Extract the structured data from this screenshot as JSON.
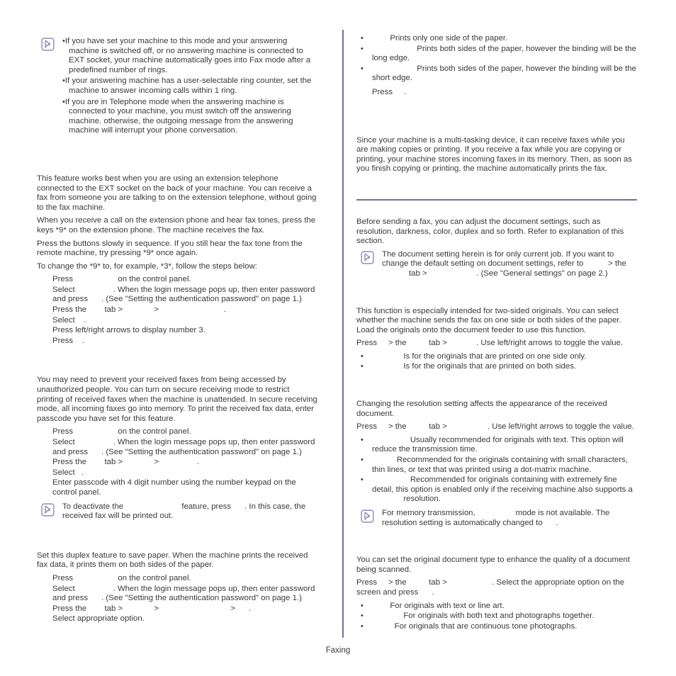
{
  "page": {
    "footer_label": "Faxing",
    "accent_color": "#6f6f9e",
    "text_color": "#3a3a3a",
    "background_color": "#ffffff",
    "hidden_term_color": "#ffffff"
  },
  "left_column": {
    "note_ans_machine": {
      "icon": "note-pencil-icon",
      "bullets": [
        "If you have set your machine to this mode and your answering machine is switched off, or no answering machine is connected to EXT socket, your machine automatically goes into Fax mode after a predefined number of rings.",
        "If your answering machine has a user-selectable ring counter, set the machine to answer incoming calls within 1 ring.",
        "If you are in Telephone mode when the answering machine is connected to your machine, you must switch off the answering machine. otherwise, the outgoing message from the answering machine will interrupt your phone conversation."
      ]
    },
    "section_ext_phone": {
      "heading": "",
      "paragraphs": [
        "This feature works best when you are using an extension telephone connected to the EXT socket on the back of your machine. You can receive a fax from someone you are talking to on the extension telephone, without going to the fax machine.",
        "When you receive a call on the extension phone and hear fax tones, press the keys *9* on the extension phone. The machine receives the fax.",
        "Press the buttons slowly in sequence. If you still hear the fax tone from the remote machine, try pressing *9* once again.",
        "To change the *9* to, for example, *3*, follow the steps below:"
      ],
      "steps": [
        {
          "lead": "Press",
          "term1": "                    ",
          "tail": "on the control panel."
        },
        {
          "lead": "Select",
          "term1": "                 ",
          "tail": ". When the login message pops up, then enter password and press",
          "term2": "      ",
          "tail2": ". (See \"Setting the authentication password\" on page 1.)"
        },
        {
          "lead": "Press the",
          "term1": "        ",
          "mid": "tab >",
          "term2": "              ",
          "mid2": ">",
          "term3": "                             ",
          "tail": "."
        },
        {
          "lead": "Select",
          "term1": "    ",
          "tail": "."
        },
        {
          "lead": "Press left/right arrows to display number 3.",
          "term1": "",
          "tail": ""
        },
        {
          "lead": "Press",
          "term1": "    ",
          "tail": "."
        }
      ]
    },
    "section_secure_receiving": {
      "heading": "",
      "paragraphs": [
        "You may need to prevent your received faxes from being accessed by unauthorized people. You can turn on secure receiving mode to restrict printing of received faxes when the machine is unattended. In secure receiving mode, all incoming faxes go into memory. To print the received fax data, enter passcode you have set for this feature."
      ],
      "steps": [
        {
          "lead": "Press",
          "term1": "                    ",
          "tail": "on the control panel."
        },
        {
          "lead": "Select",
          "term1": "                 ",
          "tail": ". When the login message pops up, then enter password and press",
          "term2": "      ",
          "tail2": ". (See \"Setting the authentication password\" on page 1.)"
        },
        {
          "lead": "Press the",
          "term1": "        ",
          "mid": "tab >",
          "term2": "              ",
          "mid2": ">",
          "term3": "                 ",
          "tail": "."
        },
        {
          "lead": "Select",
          "term1": "   ",
          "tail": "."
        },
        {
          "lead": "Enter passcode with 4 digit number using the number keypad on the control panel.",
          "term1": "",
          "tail": ""
        }
      ],
      "note": {
        "icon": "note-pencil-icon",
        "lead": "To deactivate the",
        "term1": "                          ",
        "mid": "feature, press",
        "term2": "      ",
        "tail": ". In this case, the received fax will be printed out."
      }
    },
    "section_duplex_printing": {
      "heading": "",
      "paragraphs": [
        "Set this duplex feature to save paper. When the machine prints the received fax data, it prints them on both sides of the paper."
      ],
      "steps": [
        {
          "lead": "Press",
          "term1": "                    ",
          "tail": "on the control panel."
        },
        {
          "lead": "Select",
          "term1": "                 ",
          "tail": ". When the login message pops up, then enter password and press",
          "term2": "      ",
          "tail2": ". (See \"Setting the authentication password\" on page 1.)"
        },
        {
          "lead": "Press the",
          "term1": "        ",
          "mid": "tab >",
          "term2": "              ",
          "mid2": ">",
          "term3": "                                ",
          "mid3": ">",
          "term4": "      ",
          "tail": "."
        },
        {
          "lead": "Select appropriate option.",
          "term1": "",
          "tail": ""
        }
      ]
    }
  },
  "right_column": {
    "duplex_options": {
      "bullets": [
        {
          "term": "        ",
          "text": "Prints only one side of the paper."
        },
        {
          "term": "                    ",
          "text": "Prints both sides of the paper, however the binding will be the long edge."
        },
        {
          "term": "                    ",
          "text": "Prints both sides of the paper, however the binding will be the short edge."
        }
      ],
      "final_step": {
        "lead": "Press",
        "term": "     ",
        "tail": "."
      }
    },
    "section_receiving_in_memory": {
      "heading": "",
      "paragraphs": [
        "Since your machine is a multi-tasking device, it can receive faxes while you are making copies or printing. If you receive a fax while you are copying or printing, your machine stores incoming faxes in its memory. Then, as soon as you finish copying or printing, the machine automatically prints the fax."
      ]
    },
    "section_adjusting_document": {
      "rule": true,
      "heading": "",
      "paragraphs": [
        "Before sending a fax, you can adjust the document settings, such as resolution, darkness, color, duplex and so forth. Refer to explanation of this section."
      ],
      "note": {
        "icon": "note-pencil-icon",
        "line1": "The document setting herein is for only current job. If you want to change the default setting on document settings, refer to",
        "term1": "           ",
        "mid1": "> the",
        "term2": "            ",
        "mid2": "tab >",
        "term3": "                      ",
        "tail": ". (See \"General settings\" on page 2.)"
      }
    },
    "section_duplex_originals": {
      "heading": "",
      "paragraphs": [
        "This function is especially intended for two-sided originals. You can select whether the machine sends the fax on one side or both sides of the paper. Load the originals onto the document feeder to use this function."
      ],
      "press_line": {
        "lead": "Press",
        "term1": "     ",
        "mid1": "> the",
        "term2": "          ",
        "mid2": "tab >",
        "term3": "             ",
        "tail": ". Use left/right arrows to toggle the value."
      },
      "bullets": [
        {
          "term": "              ",
          "text": "Is for the originals that are printed on one side only."
        },
        {
          "term": "              ",
          "text": "Is for the originals that are printed on both sides."
        }
      ]
    },
    "section_resolution": {
      "heading": "",
      "paragraphs": [
        "Changing the resolution setting affects the appearance of the received document."
      ],
      "press_line": {
        "lead": "Press",
        "term1": "     ",
        "mid1": "> the",
        "term2": "          ",
        "mid2": "tab >",
        "term3": "                  ",
        "tail": ". Use left/right arrows to toggle the value."
      },
      "bullets": [
        {
          "term": "                 ",
          "text": "Usually recommended for originals with text. This option will reduce the transmission time."
        },
        {
          "term": "           ",
          "text": "Recommended for the originals containing with small characters, thin lines, or text that was printed using a dot-matrix machine."
        },
        {
          "term": "                 ",
          "text": "Recommended for originals containing with extremely fine detail, this option is enabled only if the receiving machine also supports a",
          "term2": "              ",
          "text2": "resolution."
        }
      ],
      "note": {
        "icon": "note-pencil-icon",
        "lead": "For memory transmission,",
        "term1": "                  ",
        "mid": "mode is not available. The resolution setting is automatically changed to",
        "term2": "      ",
        "tail": "."
      }
    },
    "section_original_type": {
      "heading": "",
      "paragraphs": [
        "You can set the original document type to enhance the quality of a document being scanned."
      ],
      "press_line": {
        "lead": "Press",
        "term1": "     ",
        "mid1": "> the",
        "term2": "          ",
        "mid2": "tab >",
        "term3": "                    ",
        "tail": ". Select the appropriate option on the screen and press",
        "term4": "      ",
        "tail2": "."
      },
      "bullets": [
        {
          "term": "        ",
          "text": "For originals with text or line art."
        },
        {
          "term": "              ",
          "text": "For originals with both text and photographs together."
        },
        {
          "term": "          ",
          "text": "For originals that are continuous tone photographs."
        }
      ]
    }
  }
}
